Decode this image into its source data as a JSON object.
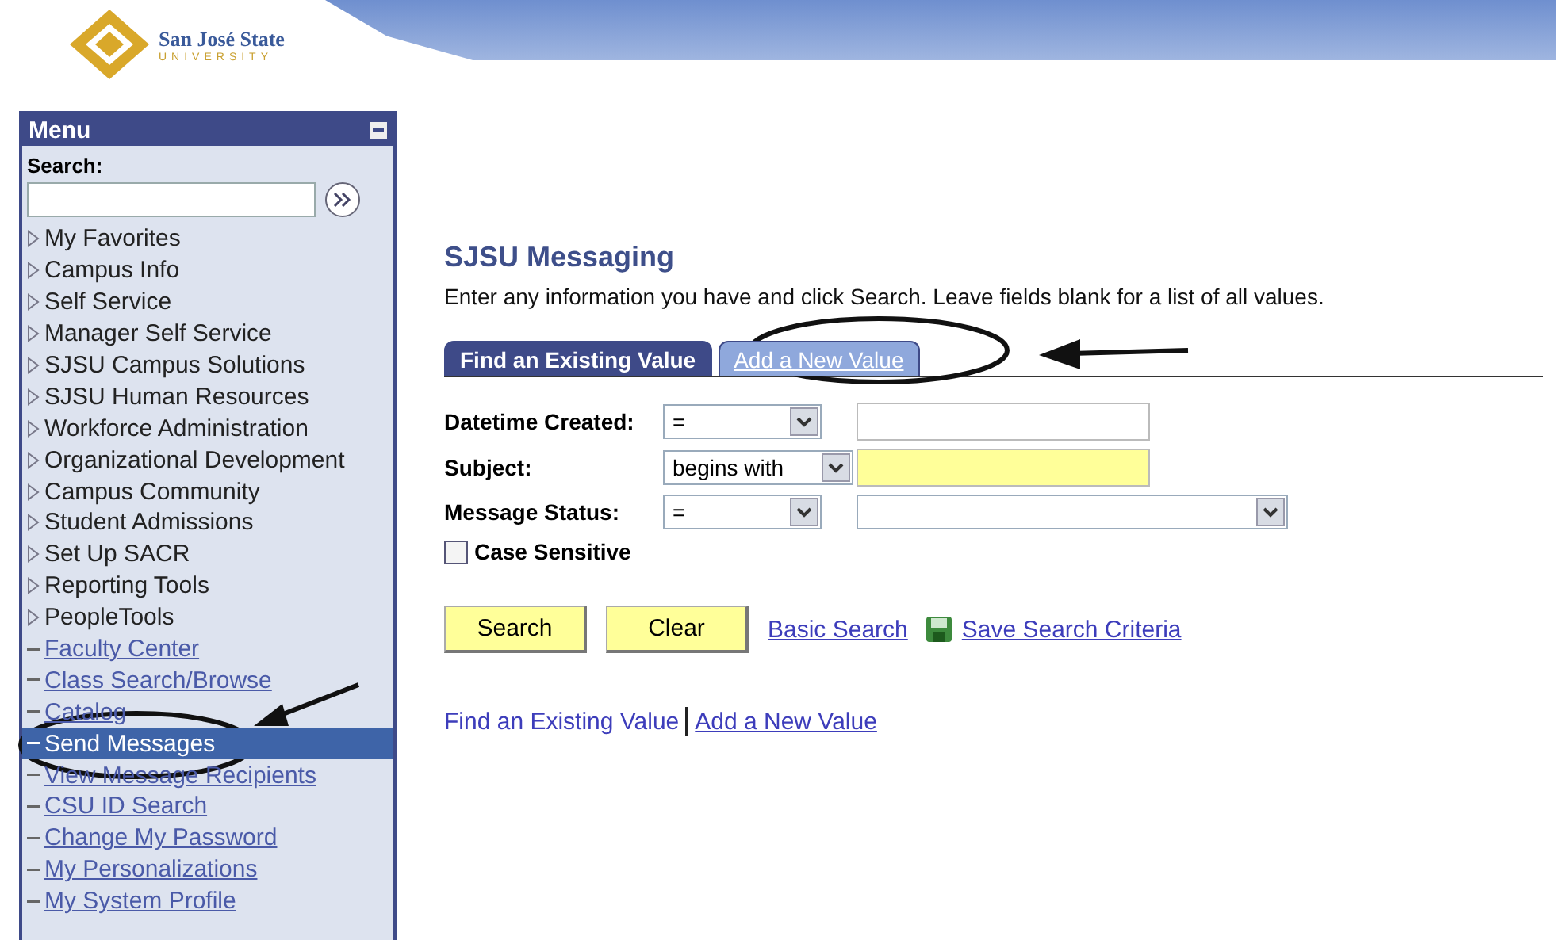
{
  "logo": {
    "name": "San José State",
    "sub": "UNIVERSITY"
  },
  "menu": {
    "title": "Menu",
    "search_label": "Search:",
    "items": [
      {
        "label": "My Favorites",
        "kind": "folder",
        "selected": false
      },
      {
        "label": "Campus Info",
        "kind": "folder",
        "selected": false
      },
      {
        "label": "Self Service",
        "kind": "folder",
        "selected": false
      },
      {
        "label": "Manager Self Service",
        "kind": "folder",
        "selected": false
      },
      {
        "label": "SJSU Campus Solutions",
        "kind": "folder",
        "selected": false
      },
      {
        "label": "SJSU Human Resources",
        "kind": "folder",
        "selected": false
      },
      {
        "label": "Workforce Administration",
        "kind": "folder",
        "selected": false
      },
      {
        "label": "Organizational Development",
        "kind": "folder",
        "selected": false
      },
      {
        "label": "Campus Community",
        "kind": "folder",
        "selected": false
      },
      {
        "label": "Student Admissions",
        "kind": "folder",
        "selected": false
      },
      {
        "label": "Set Up SACR",
        "kind": "folder",
        "selected": false
      },
      {
        "label": "Reporting Tools",
        "kind": "folder",
        "selected": false
      },
      {
        "label": "PeopleTools",
        "kind": "folder",
        "selected": false
      },
      {
        "label": "Faculty Center",
        "kind": "link",
        "selected": false
      },
      {
        "label": "Class Search/Browse",
        "kind": "link",
        "selected": false
      },
      {
        "label": "Catalog",
        "kind": "link",
        "selected": false
      },
      {
        "label": "Send Messages",
        "kind": "link",
        "selected": true
      },
      {
        "label": "View Message Recipients",
        "kind": "link",
        "selected": false
      },
      {
        "label": "CSU ID Search",
        "kind": "link",
        "selected": false
      },
      {
        "label": "Change My Password",
        "kind": "link",
        "selected": false
      },
      {
        "label": "My Personalizations",
        "kind": "link",
        "selected": false
      },
      {
        "label": "My System Profile",
        "kind": "link",
        "selected": false
      }
    ]
  },
  "page": {
    "title": "SJSU Messaging",
    "instructions": "Enter any information you have and click Search. Leave fields blank for a list of all values.",
    "tabs": [
      {
        "label": "Find an Existing Value",
        "selected": true
      },
      {
        "label": "Add a New Value",
        "selected": false
      }
    ],
    "fields": [
      {
        "label": "Datetime Created:",
        "operator": "=",
        "kind": "text"
      },
      {
        "label": "Subject:",
        "operator": "begins with",
        "kind": "required"
      },
      {
        "label": "Message Status:",
        "operator": "=",
        "kind": "select"
      }
    ],
    "case_sensitive": {
      "label": "Case Sensitive",
      "checked": false
    },
    "buttons": [
      "Search",
      "Clear"
    ],
    "links": [
      "Basic Search",
      "Save Search Criteria"
    ],
    "footer_links": [
      {
        "label": "Find an Existing Value",
        "selected": true
      },
      {
        "label": "Add a New Value",
        "selected": false
      }
    ]
  }
}
